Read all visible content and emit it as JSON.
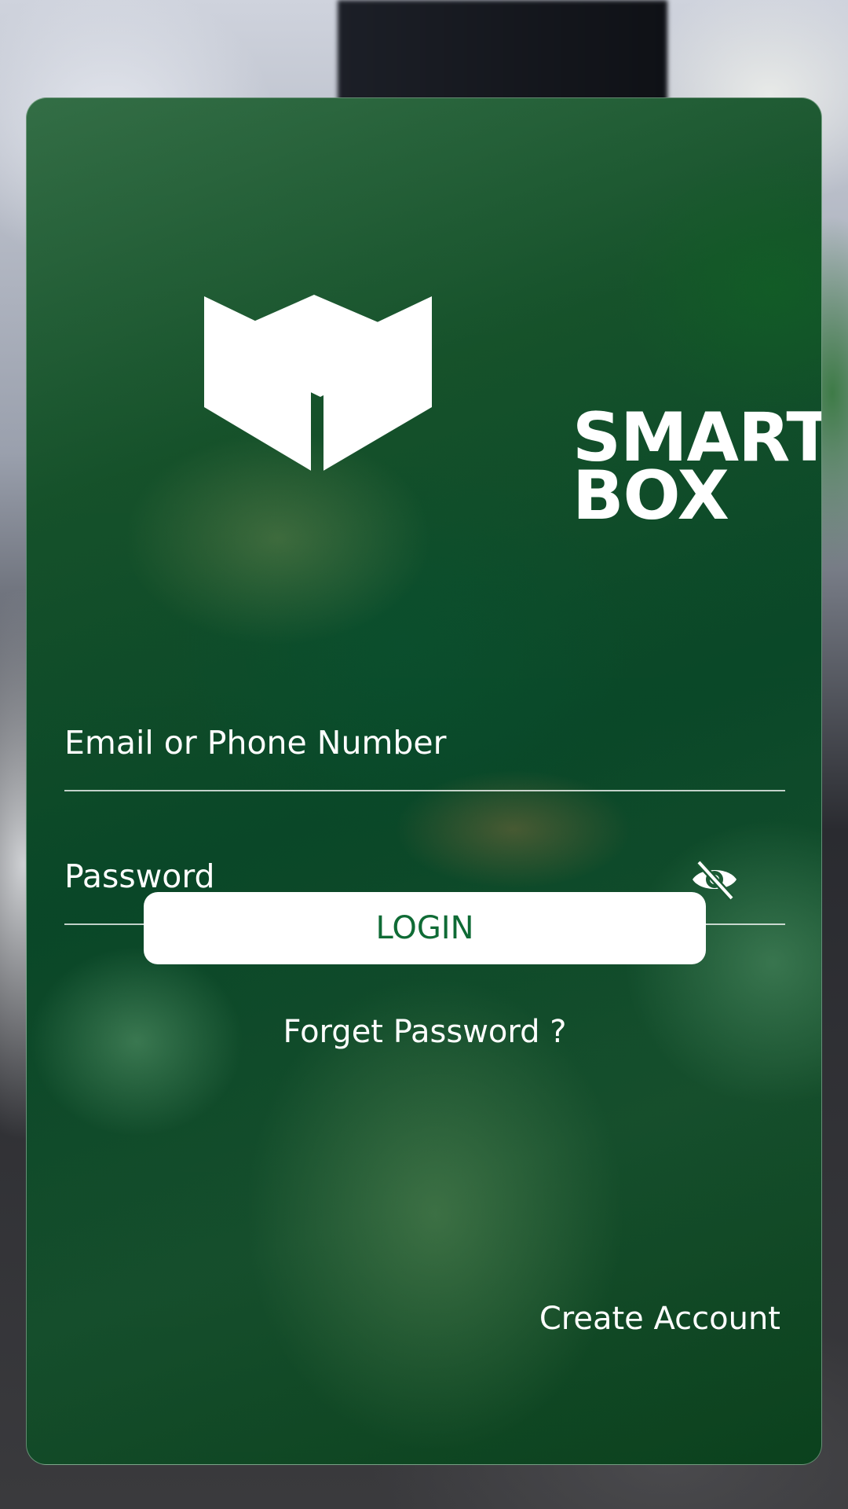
{
  "brand": {
    "line1": "SMART",
    "line2": "BOX",
    "logo_icon": "cube-icon"
  },
  "form": {
    "email_placeholder": "Email or Phone Number",
    "password_placeholder": "Password",
    "password_toggle_icon": "eye-off-icon"
  },
  "actions": {
    "login_label": "LOGIN",
    "forget_password_label": "Forget Password ?",
    "create_account_label": "Create Account"
  },
  "colors": {
    "accent_green": "#0f6b35",
    "button_bg": "#ffffff",
    "text": "#ffffff"
  }
}
